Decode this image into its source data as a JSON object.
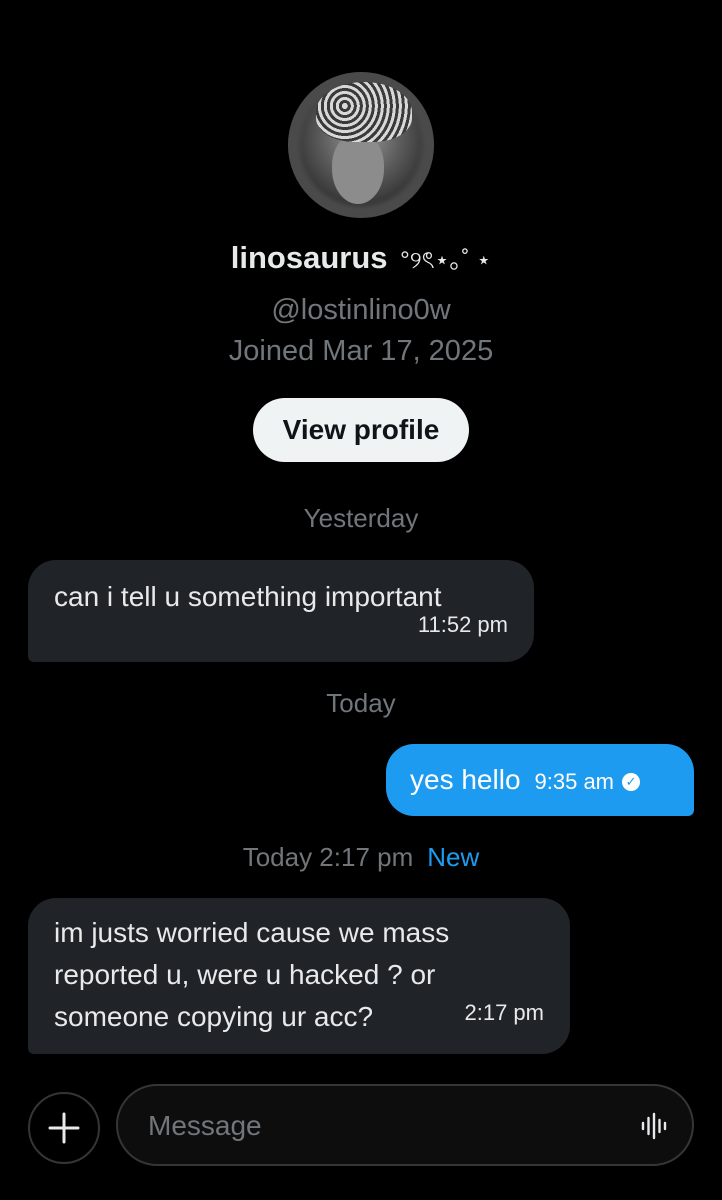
{
  "profile": {
    "display_name": "linosaurus",
    "display_name_decoration": "°୨ৎ⋆｡˚ ⋆",
    "handle": "@lostinlino0w",
    "joined": "Joined Mar 17, 2025",
    "view_profile_label": "View profile"
  },
  "conversation": {
    "separator_yesterday": "Yesterday",
    "message_1": {
      "text": "can i tell u something important",
      "time": "11:52 pm"
    },
    "separator_today": "Today",
    "message_2": {
      "text": "yes hello",
      "time": "9:35 am",
      "status_icon": "read-check-icon"
    },
    "separator_new_time": "Today 2:17 pm",
    "separator_new_label": "New",
    "message_3": {
      "line1": "im justs worried cause we mass",
      "line2": "reported u, were u hacked ? or",
      "line3": "someone copying ur acc?",
      "time": "2:17 pm"
    }
  },
  "composer": {
    "add_icon": "plus-icon",
    "placeholder": "Message",
    "voice_icon": "voice-waveform-icon"
  },
  "colors": {
    "background": "#000000",
    "incoming_bubble": "#202327",
    "outgoing_bubble": "#1d9bf0",
    "muted_text": "#71767b",
    "accent": "#1d9bf0"
  }
}
